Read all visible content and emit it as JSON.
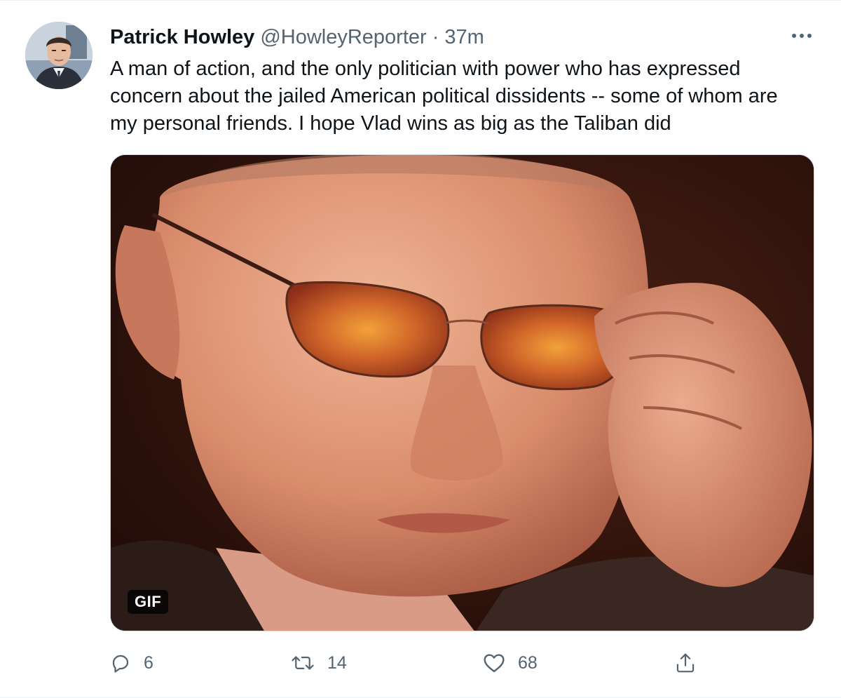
{
  "tweet": {
    "author_name": "Patrick Howley",
    "handle": "@HowleyReporter",
    "separator": "·",
    "time": "37m",
    "text_lines": [
      "A man of action, and the only politician with power who has expressed",
      "concern about the jailed American political dissidents -- some of whom are",
      "my personal friends. I hope Vlad wins as big as the Taliban did"
    ],
    "media": {
      "badge": "GIF"
    },
    "actions": {
      "reply_count": "6",
      "retweet_count": "14",
      "like_count": "68"
    }
  },
  "icons": {
    "more": "more-horizontal-icon",
    "reply": "reply-icon",
    "retweet": "retweet-icon",
    "like": "heart-icon",
    "share": "share-icon"
  },
  "colors": {
    "text": "#0f1419",
    "secondary": "#536471",
    "border": "#cfd9de"
  }
}
